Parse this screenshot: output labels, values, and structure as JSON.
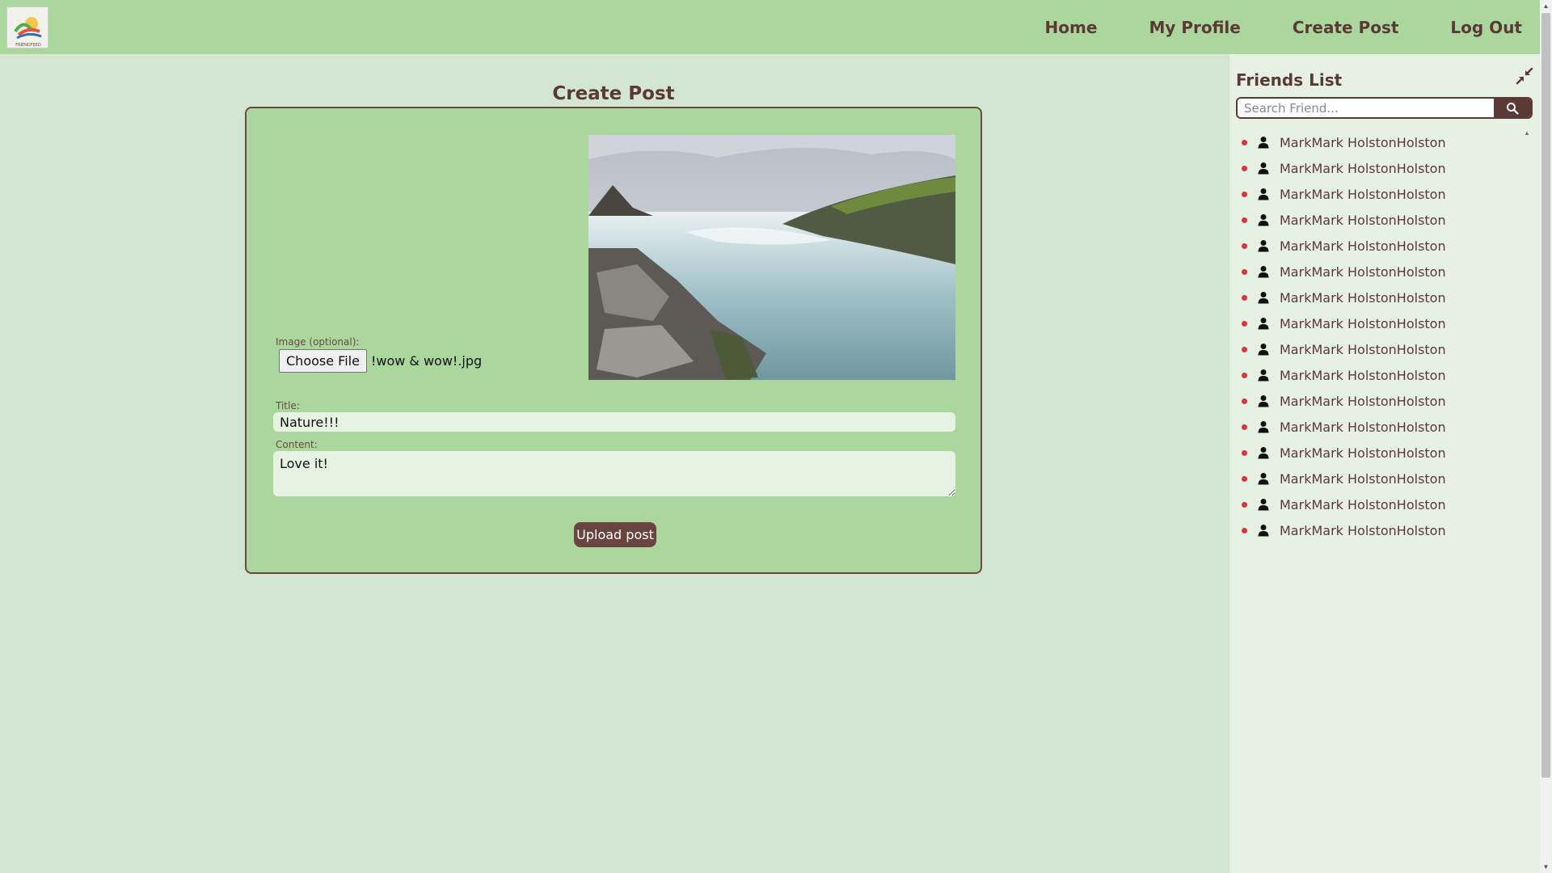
{
  "nav": {
    "logo_text": "FRIENDFEED",
    "links": [
      {
        "label": "Home"
      },
      {
        "label": "My Profile"
      },
      {
        "label": "Create Post"
      },
      {
        "label": "Log Out"
      }
    ]
  },
  "create_post": {
    "heading": "Create Post",
    "image_label": "Image (optional):",
    "choose_file_label": "Choose File",
    "file_name": "!wow & wow!.jpg",
    "title_label": "Title:",
    "title_value": "Nature!!!",
    "content_label": "Content:",
    "content_value": "Love it!",
    "upload_label": "Upload post"
  },
  "friends": {
    "title": "Friends List",
    "search_placeholder": "Search Friend...",
    "status_color": "#e03232",
    "items": [
      {
        "name": "MarkMark HolstonHolston"
      },
      {
        "name": "MarkMark HolstonHolston"
      },
      {
        "name": "MarkMark HolstonHolston"
      },
      {
        "name": "MarkMark HolstonHolston"
      },
      {
        "name": "MarkMark HolstonHolston"
      },
      {
        "name": "MarkMark HolstonHolston"
      },
      {
        "name": "MarkMark HolstonHolston"
      },
      {
        "name": "MarkMark HolstonHolston"
      },
      {
        "name": "MarkMark HolstonHolston"
      },
      {
        "name": "MarkMark HolstonHolston"
      },
      {
        "name": "MarkMark HolstonHolston"
      },
      {
        "name": "MarkMark HolstonHolston"
      },
      {
        "name": "MarkMark HolstonHolston"
      },
      {
        "name": "MarkMark HolstonHolston"
      },
      {
        "name": "MarkMark HolstonHolston"
      },
      {
        "name": "MarkMark HolstonHolston"
      }
    ]
  },
  "colors": {
    "nav_bg": "#abd79e",
    "page_bg": "#d3e6d2",
    "brand_brown": "#5b3a35",
    "panel_bg": "#e6f1e4"
  }
}
